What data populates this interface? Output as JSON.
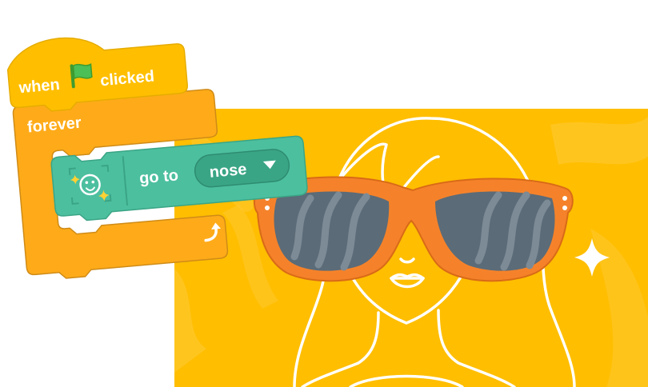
{
  "scripts": {
    "hat": {
      "label_before": "when",
      "label_after": "clicked",
      "icon": "green-flag-icon"
    },
    "loop": {
      "label": "forever",
      "icon": "loop-arrow-icon"
    },
    "motion": {
      "label": "go to",
      "dropdown_value": "nose",
      "icon": "face-sensing-icon"
    }
  },
  "stage": {
    "description_icon": "girl-with-sunglasses-illustration",
    "sparkle_icon": "sparkle-icon"
  },
  "colors": {
    "events": "#FFBF00",
    "events_shade": "#E6AC00",
    "control": "#FFAB19",
    "control_shade": "#CF8B17",
    "extension": "#4CBF9F",
    "extension_shade": "#3AA585",
    "stage_bg": "#FFC000",
    "glasses": "#F5822A",
    "lenses": "#5B6B78"
  }
}
